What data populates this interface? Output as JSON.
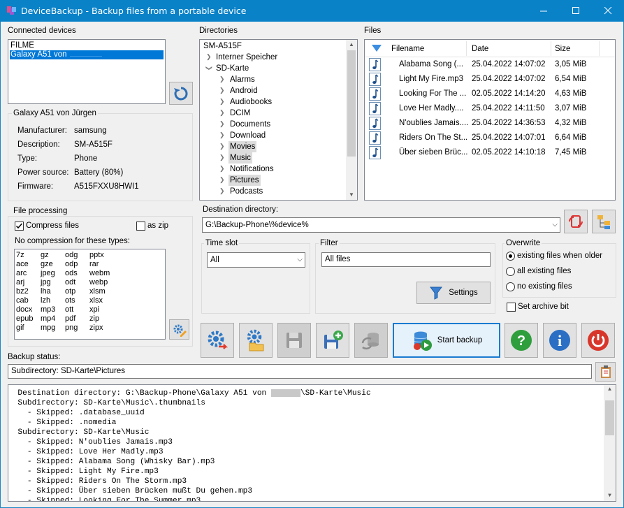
{
  "window": {
    "title": "DeviceBackup - Backup files from a portable device",
    "accent": "#0a82c8"
  },
  "connected_devices": {
    "label": "Connected devices",
    "items": [
      "FILME",
      "Galaxy A51 von"
    ],
    "selected_index": 1
  },
  "device_info": {
    "title": "Galaxy A51 von Jürgen",
    "rows": [
      {
        "label": "Manufacturer:",
        "value": "samsung"
      },
      {
        "label": "Description:",
        "value": "SM-A515F"
      },
      {
        "label": "Type:",
        "value": "Phone"
      },
      {
        "label": "Power source:",
        "value": "Battery (80%)"
      },
      {
        "label": "Firmware:",
        "value": "A515FXXU8HWI1"
      }
    ]
  },
  "directories": {
    "label": "Directories",
    "root": "SM-A515F",
    "internal": "Interner Speicher",
    "sd": "SD-Karte",
    "children": [
      "Alarms",
      "Android",
      "Audiobooks",
      "DCIM",
      "Documents",
      "Download",
      "Movies",
      "Music",
      "Notifications",
      "Pictures",
      "Podcasts"
    ],
    "highlighted": [
      "Movies",
      "Music",
      "Pictures"
    ]
  },
  "files": {
    "label": "Files",
    "columns": [
      "Filename",
      "Date",
      "Size"
    ],
    "rows": [
      {
        "name": "Alabama Song (...",
        "date": "25.04.2022 14:07:02",
        "size": "3,05 MiB"
      },
      {
        "name": "Light My Fire.mp3",
        "date": "25.04.2022 14:07:02",
        "size": "6,54 MiB"
      },
      {
        "name": "Looking For The ...",
        "date": "02.05.2022 14:14:20",
        "size": "4,63 MiB"
      },
      {
        "name": "Love Her Madly....",
        "date": "25.04.2022 14:11:50",
        "size": "3,07 MiB"
      },
      {
        "name": "N'oublies Jamais....",
        "date": "25.04.2022 14:36:53",
        "size": "4,32 MiB"
      },
      {
        "name": "Riders On The St...",
        "date": "25.04.2022 14:07:01",
        "size": "6,64 MiB"
      },
      {
        "name": "Über sieben Brüc...",
        "date": "02.05.2022 14:10:18",
        "size": "7,45 MiB"
      }
    ]
  },
  "file_processing": {
    "title": "File processing",
    "compress_label": "Compress files",
    "compress_checked": true,
    "zip_label": "as zip",
    "zip_checked": false,
    "no_compression_label": "No compression for these types:",
    "types": [
      [
        "7z",
        "gz",
        "odg",
        "pptx"
      ],
      [
        "ace",
        "gze",
        "odp",
        "rar"
      ],
      [
        "arc",
        "jpeg",
        "ods",
        "webm"
      ],
      [
        "arj",
        "jpg",
        "odt",
        "webp"
      ],
      [
        "bz2",
        "lha",
        "otp",
        "xlsm"
      ],
      [
        "cab",
        "lzh",
        "ots",
        "xlsx"
      ],
      [
        "docx",
        "mp3",
        "ott",
        "xpi"
      ],
      [
        "epub",
        "mp4",
        "pdf",
        "zip"
      ],
      [
        "gif",
        "mpg",
        "png",
        "zipx"
      ]
    ]
  },
  "destination": {
    "label": "Destination directory:",
    "value": "G:\\Backup-Phone\\%device%"
  },
  "time_slot": {
    "title": "Time slot",
    "value": "All"
  },
  "filter": {
    "title": "Filter",
    "value": "All files",
    "settings_label": "Settings"
  },
  "overwrite": {
    "title": "Overwrite",
    "options": [
      "existing files when older",
      "all existing files",
      "no existing files"
    ],
    "selected_index": 0
  },
  "archive_bit": {
    "label": "Set archive bit",
    "checked": false
  },
  "start_backup": {
    "label": "Start backup"
  },
  "backup_status": {
    "label": "Backup status:",
    "value": "Subdirectory: SD-Karte\\Pictures"
  },
  "log": {
    "first_prefix": "  Destination directory: G:\\Backup-Phone\\Galaxy A51 von ",
    "first_suffix": "\\SD-Karte\\Music",
    "lines": [
      "  Subdirectory: SD-Karte\\Music\\.thumbnails",
      "    - Skipped: .database_uuid",
      "    - Skipped: .nomedia",
      "  Subdirectory: SD-Karte\\Music",
      "    - Skipped: N'oublies Jamais.mp3",
      "    - Skipped: Love Her Madly.mp3",
      "    - Skipped: Alabama Song (Whisky Bar).mp3",
      "    - Skipped: Light My Fire.mp3",
      "    - Skipped: Riders On The Storm.mp3",
      "    - Skipped: Über sieben Brücken mußt Du gehen.mp3",
      "    - Skipped: Looking For The Summer.mp3"
    ]
  }
}
